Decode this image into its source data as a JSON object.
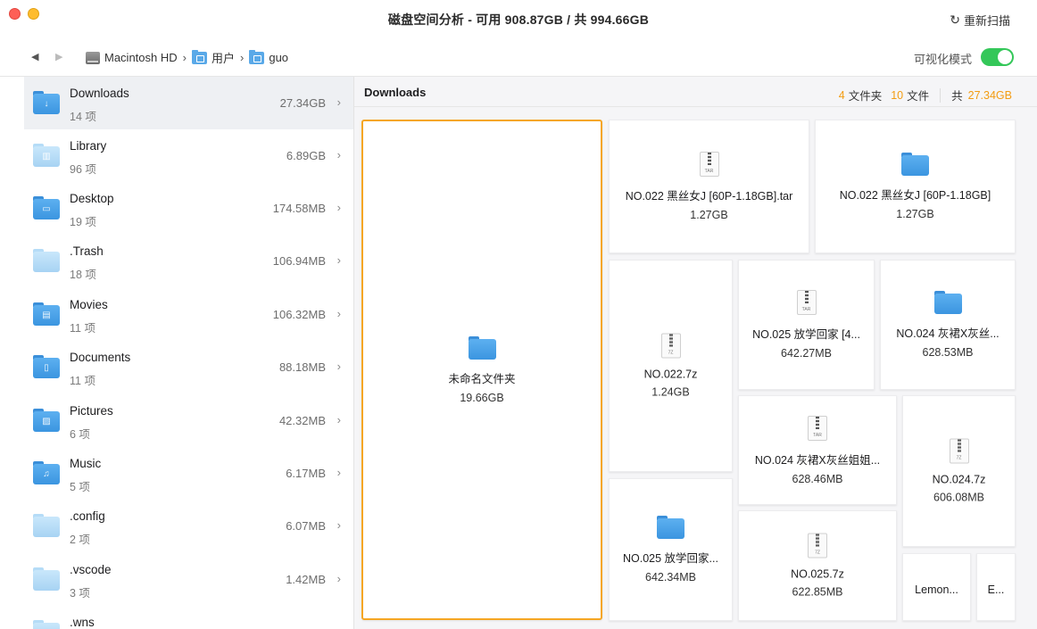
{
  "titlebar": {
    "title": "磁盘空间分析 - 可用 908.87GB / 共 994.66GB",
    "rescan_label": "重新扫描",
    "rescan_icon": "refresh-icon"
  },
  "pathbar": {
    "crumbs": [
      "Macintosh HD",
      "用户",
      "guo"
    ],
    "visual_mode_label": "可视化模式",
    "visual_mode_on": true
  },
  "sidebar": {
    "items": [
      {
        "name": "Downloads",
        "count": "14 项",
        "size": "27.34GB",
        "icon": "downloads-folder-icon",
        "emblem": "↓",
        "style": "blue"
      },
      {
        "name": "Library",
        "count": "96 项",
        "size": "6.89GB",
        "icon": "library-folder-icon",
        "emblem": "▥",
        "style": "light"
      },
      {
        "name": "Desktop",
        "count": "19 项",
        "size": "174.58MB",
        "icon": "desktop-folder-icon",
        "emblem": "▭",
        "style": "blue"
      },
      {
        "name": ".Trash",
        "count": "18 项",
        "size": "106.94MB",
        "icon": "folder-icon",
        "emblem": "",
        "style": "light"
      },
      {
        "name": "Movies",
        "count": "11 项",
        "size": "106.32MB",
        "icon": "movies-folder-icon",
        "emblem": "▤",
        "style": "blue"
      },
      {
        "name": "Documents",
        "count": "11 项",
        "size": "88.18MB",
        "icon": "documents-folder-icon",
        "emblem": "▯",
        "style": "blue"
      },
      {
        "name": "Pictures",
        "count": "6 项",
        "size": "42.32MB",
        "icon": "pictures-folder-icon",
        "emblem": "▨",
        "style": "blue"
      },
      {
        "name": "Music",
        "count": "5 项",
        "size": "6.17MB",
        "icon": "music-folder-icon",
        "emblem": "♫",
        "style": "blue"
      },
      {
        "name": ".config",
        "count": "2 项",
        "size": "6.07MB",
        "icon": "folder-icon",
        "emblem": "",
        "style": "light"
      },
      {
        "name": ".vscode",
        "count": "3 项",
        "size": "1.42MB",
        "icon": "folder-icon",
        "emblem": "",
        "style": "light"
      },
      {
        "name": ".wns",
        "count": "",
        "size": "",
        "icon": "folder-icon",
        "emblem": "",
        "style": "light"
      }
    ]
  },
  "main": {
    "title": "Downloads",
    "folders_num": "4",
    "folders_label": "文件夹",
    "files_num": "10",
    "files_label": "文件",
    "total_label": "共",
    "total_size": "27.34GB",
    "tiles": [
      {
        "name": "未命名文件夹",
        "size": "19.66GB",
        "kind": "folder"
      },
      {
        "name": "NO.022 黑丝女J [60P-1.18GB].tar",
        "size": "1.27GB",
        "kind": "archive",
        "ext": "TAR"
      },
      {
        "name": "NO.022 黑丝女J [60P-1.18GB]",
        "size": "1.27GB",
        "kind": "folder"
      },
      {
        "name": "NO.022.7z",
        "size": "1.24GB",
        "kind": "archive",
        "ext": "7Z"
      },
      {
        "name": "NO.025 放学回家 [4...",
        "size": "642.27MB",
        "kind": "archive",
        "ext": "TAR"
      },
      {
        "name": "NO.024 灰裙X灰丝...",
        "size": "628.53MB",
        "kind": "folder"
      },
      {
        "name": "NO.024 灰裙X灰丝姐姐...",
        "size": "628.46MB",
        "kind": "archive",
        "ext": "TAR"
      },
      {
        "name": "NO.024.7z",
        "size": "606.08MB",
        "kind": "archive",
        "ext": "7Z"
      },
      {
        "name": "NO.025 放学回家...",
        "size": "642.34MB",
        "kind": "folder"
      },
      {
        "name": "NO.025.7z",
        "size": "622.85MB",
        "kind": "archive",
        "ext": "7Z"
      },
      {
        "name": "Lemon...",
        "size": "",
        "kind": "none"
      },
      {
        "name": "E...",
        "size": "",
        "kind": "none"
      }
    ]
  }
}
